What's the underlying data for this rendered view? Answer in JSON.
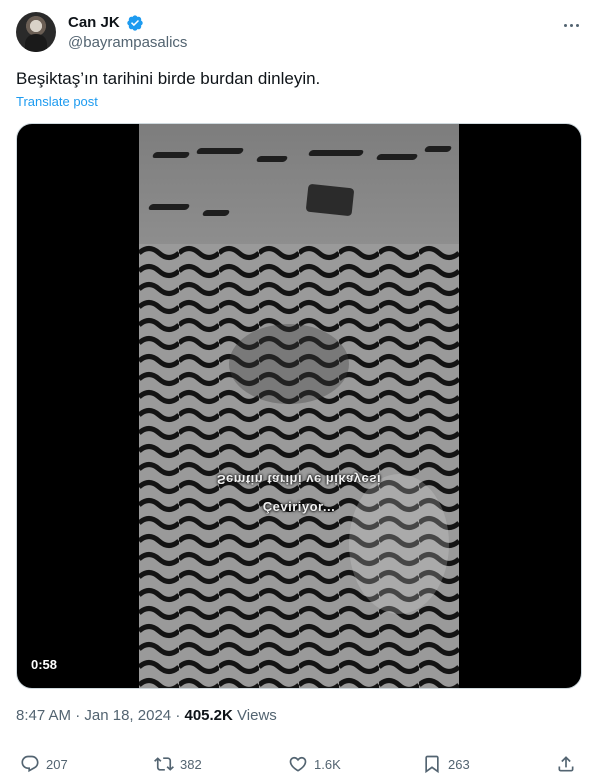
{
  "author": {
    "display_name": "Can JK",
    "handle": "@bayrampasalics",
    "verified_color": "#1d9bf0"
  },
  "post": {
    "text": "Beşiktaş’ın tarihini birde burdan dinleyin.",
    "translate_label": "Translate post"
  },
  "media": {
    "caption_line1": "Semtin tarihi ve hikayesi",
    "caption_line2": "Çeviriyor...",
    "duration": "0:58"
  },
  "meta": {
    "time": "8:47 AM",
    "date": "Jan 18, 2024",
    "separator": "·",
    "views_count": "405.2K",
    "views_label": "Views"
  },
  "actions": {
    "replies": "207",
    "reposts": "382",
    "likes": "1.6K",
    "bookmarks": "263"
  },
  "icons": {
    "reply": "reply-icon",
    "repost": "repost-icon",
    "like": "heart-icon",
    "bookmark": "bookmark-icon",
    "share": "share-icon",
    "more": "more-icon",
    "verified": "verified-badge-icon"
  }
}
